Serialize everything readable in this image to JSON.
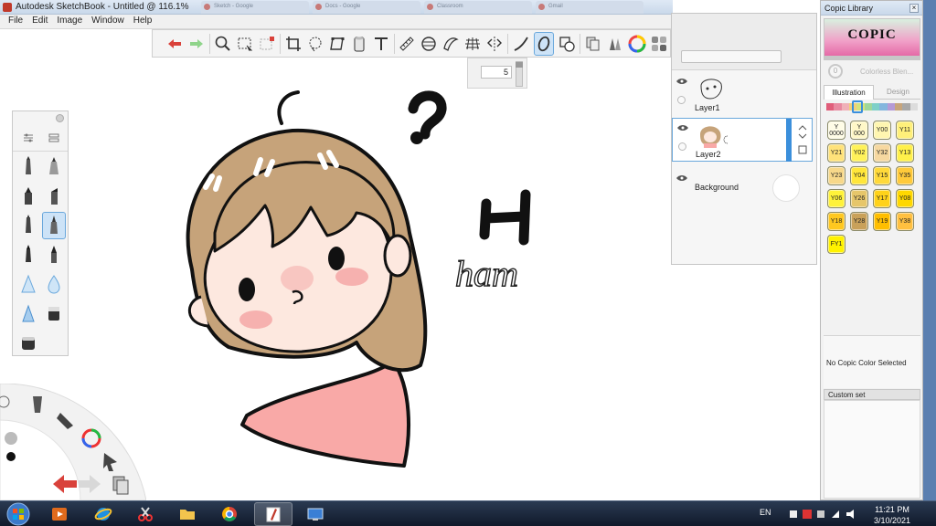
{
  "window": {
    "title": "Autodesk SketchBook - Untitled @ 116.1%"
  },
  "browser_tabs": [
    "Sketch - Google",
    "Docs - Google",
    "Classroom",
    "Gmail"
  ],
  "menu": [
    "File",
    "Edit",
    "Image",
    "Window",
    "Help"
  ],
  "toolbar": {
    "icons": [
      "undo-icon",
      "redo-icon",
      "zoom-icon",
      "select-icon",
      "crop-select-icon",
      "crop-icon",
      "lasso-icon",
      "transform-icon",
      "bucket-icon",
      "text-icon",
      "ruler-icon",
      "ellipse-guide-icon",
      "french-curve-icon",
      "perspective-icon",
      "symmetry-icon",
      "stroke-icon",
      "brush-selected-icon",
      "layer-blend-icon",
      "copy-icon",
      "brushes-icon",
      "color-wheel-icon",
      "swatches-icon"
    ]
  },
  "brush_size": {
    "value": "5"
  },
  "canvas": {
    "scribble_text": "ham"
  },
  "layers": {
    "items": [
      {
        "name": "Layer1",
        "visible": true,
        "selected": false
      },
      {
        "name": "Layer2",
        "visible": true,
        "selected": true
      },
      {
        "name": "Background",
        "visible": true,
        "selected": false
      }
    ]
  },
  "copic": {
    "title": "Copic Library",
    "logo_text": "COPIC",
    "colorless_blender": "Colorless Blen...",
    "tabs": [
      "Illustration",
      "Design"
    ],
    "families": [
      "#e05d7a",
      "#e889a0",
      "#f0b0b8",
      "#f1d07a",
      "#d7e37a",
      "#9fd79a",
      "#7fd0c8",
      "#84b6de",
      "#b59ad6",
      "#c7a57c",
      "#a8a8a8",
      "#dcdcdc"
    ],
    "swatches": [
      {
        "label": "Y\n0000",
        "color": "#fffce6"
      },
      {
        "label": "Y\n000",
        "color": "#fff8c8"
      },
      {
        "label": "Y00",
        "color": "#fff6b0"
      },
      {
        "label": "Y11",
        "color": "#fff07a"
      },
      {
        "label": "Y21",
        "color": "#ffe27a"
      },
      {
        "label": "Y02",
        "color": "#fff25a"
      },
      {
        "label": "Y32",
        "color": "#f6d8a0"
      },
      {
        "label": "Y13",
        "color": "#fff04a"
      },
      {
        "label": "Y23",
        "color": "#f7d88a"
      },
      {
        "label": "Y04",
        "color": "#ffe63a"
      },
      {
        "label": "Y15",
        "color": "#ffd93a"
      },
      {
        "label": "Y35",
        "color": "#ffca3a"
      },
      {
        "label": "Y06",
        "color": "#fff23a"
      },
      {
        "label": "Y26",
        "color": "#e6c66a"
      },
      {
        "label": "Y17",
        "color": "#ffd21a"
      },
      {
        "label": "Y08",
        "color": "#ffd800"
      },
      {
        "label": "Y18",
        "color": "#ffc820"
      },
      {
        "label": "Y28",
        "color": "#c9a15a"
      },
      {
        "label": "Y19",
        "color": "#ffbe00"
      },
      {
        "label": "Y38",
        "color": "#ffc040"
      },
      {
        "label": "FY1",
        "color": "#fff200"
      }
    ],
    "no_selection": "No Copic Color Selected",
    "custom_set": "Custom set"
  },
  "taskbar": {
    "apps": [
      "media-player-icon",
      "internet-explorer-icon",
      "snipping-tool-icon",
      "file-explorer-icon",
      "chrome-icon",
      "sketchbook-icon",
      "remote-desktop-icon"
    ],
    "language": "EN",
    "time": "11:21 PM",
    "date": "3/10/2021"
  }
}
